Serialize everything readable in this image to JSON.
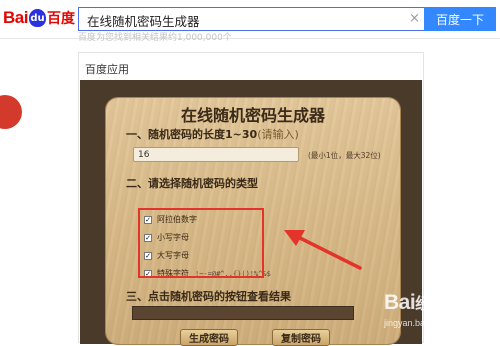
{
  "search": {
    "logo_en": "Bai",
    "logo_paw": "du",
    "logo_cn": "百度",
    "query": "在线随机密码生成器",
    "clear_glyph": "×",
    "button_label": "百度一下",
    "faded_line": "百度为您找到相关结果约1,000,000个"
  },
  "card": {
    "title": "百度应用",
    "app": {
      "title": "在线随机密码生成器",
      "section1": "一、随机密码的长度1~30",
      "section1_hint": "(请输入)",
      "length_value": "16",
      "length_note": "(最小1位，最大32位)",
      "section2": "二、请选择随机密码的类型",
      "options": [
        {
          "label": "阿拉伯数字",
          "extra": "",
          "checked": true
        },
        {
          "label": "小写字母",
          "extra": "",
          "checked": true
        },
        {
          "label": "大写字母",
          "extra": "",
          "checked": true
        },
        {
          "label": "特殊字符",
          "extra": "!~-=@#^,.{}()!%^&$",
          "checked": true
        }
      ],
      "section3": "三、点击随机密码的按钮查看结果",
      "result_value": "",
      "generate_button": "生成密码",
      "copy_button": "复制密码"
    }
  },
  "watermark": {
    "brand_en": "Bai",
    "brand_cn": "经验",
    "url": "jingyan.baidu.com"
  },
  "colors": {
    "accent": "#3388ff",
    "brand_red": "#e10601",
    "annotation_red": "#e3342c",
    "wood": "#d8b987"
  }
}
